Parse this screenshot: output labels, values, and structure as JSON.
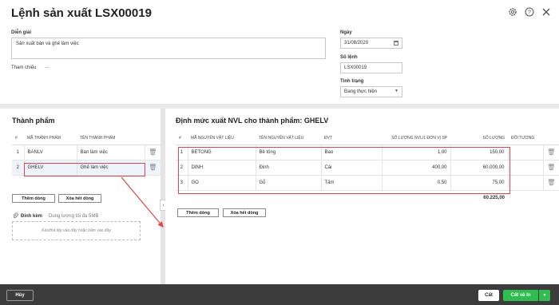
{
  "header": {
    "title": "Lệnh sản xuất LSX00019",
    "description_label": "Diễn giải",
    "description_value": "Sản xuất bàn và ghế làm việc",
    "reference_label": "Tham chiếu",
    "reference_value": "...",
    "date_label": "Ngày",
    "date_value": "31/08/2020",
    "order_no_label": "Số lệnh",
    "order_no_value": "LSX00019",
    "status_label": "Tình trạng",
    "status_value": "Đang thực hiện"
  },
  "products": {
    "section_title": "Thành phẩm",
    "columns": [
      "#",
      "MÃ THÀNH PHẨM",
      "TÊN THÀNH PHẨM"
    ],
    "rows": [
      {
        "idx": "1",
        "code": "BANLV",
        "name": "Bàn làm việc"
      },
      {
        "idx": "2",
        "code": "GHELV",
        "name": "Ghế làm việc"
      }
    ],
    "add_row_label": "Thêm dòng",
    "clear_rows_label": "Xóa hết dòng",
    "attach_label": "Đính kèm",
    "attach_hint": "Dung lượng tối đa 5MB",
    "drop_hint": "Kéo/thả tệp vào đây hoặc bấm vào đây"
  },
  "materials": {
    "section_title": "Định mức xuất NVL cho thành phẩm: GHELV",
    "columns": [
      "#",
      "MÃ NGUYÊN VẬT LIỆU",
      "TÊN NGUYÊN VẬT LIỆU",
      "ĐVT",
      "SỐ LƯỢNG NVL/1 ĐƠN VỊ SP",
      "SỐ LƯỢNG",
      "ĐỐI TƯỢNG"
    ],
    "rows": [
      {
        "idx": "1",
        "code": "BETONG",
        "name": "Bê tông",
        "unit": "Bao",
        "per_unit": "1,00",
        "qty": "150,00"
      },
      {
        "idx": "2",
        "code": "DINH",
        "name": "Đinh",
        "unit": "Cái",
        "per_unit": "400,00",
        "qty": "60.000,00"
      },
      {
        "idx": "3",
        "code": "GO",
        "name": "Gỗ",
        "unit": "Tấm",
        "per_unit": "0,50",
        "qty": "75,00"
      }
    ],
    "total_qty": "60.225,00",
    "add_row_label": "Thêm dòng",
    "clear_rows_label": "Xóa hết dòng"
  },
  "footer": {
    "cancel_label": "Hủy",
    "save_label": "Cất",
    "save_print_label": "Cất và In"
  },
  "icons": {
    "settings": "gear-icon",
    "help": "help-icon",
    "close": "close-icon",
    "calendar": "calendar-icon",
    "delete": "trash-icon",
    "attach": "paperclip-icon"
  },
  "colors": {
    "highlight": "#e04646",
    "primary": "#2ebd4e",
    "footer_bg": "#3c3c3c"
  }
}
